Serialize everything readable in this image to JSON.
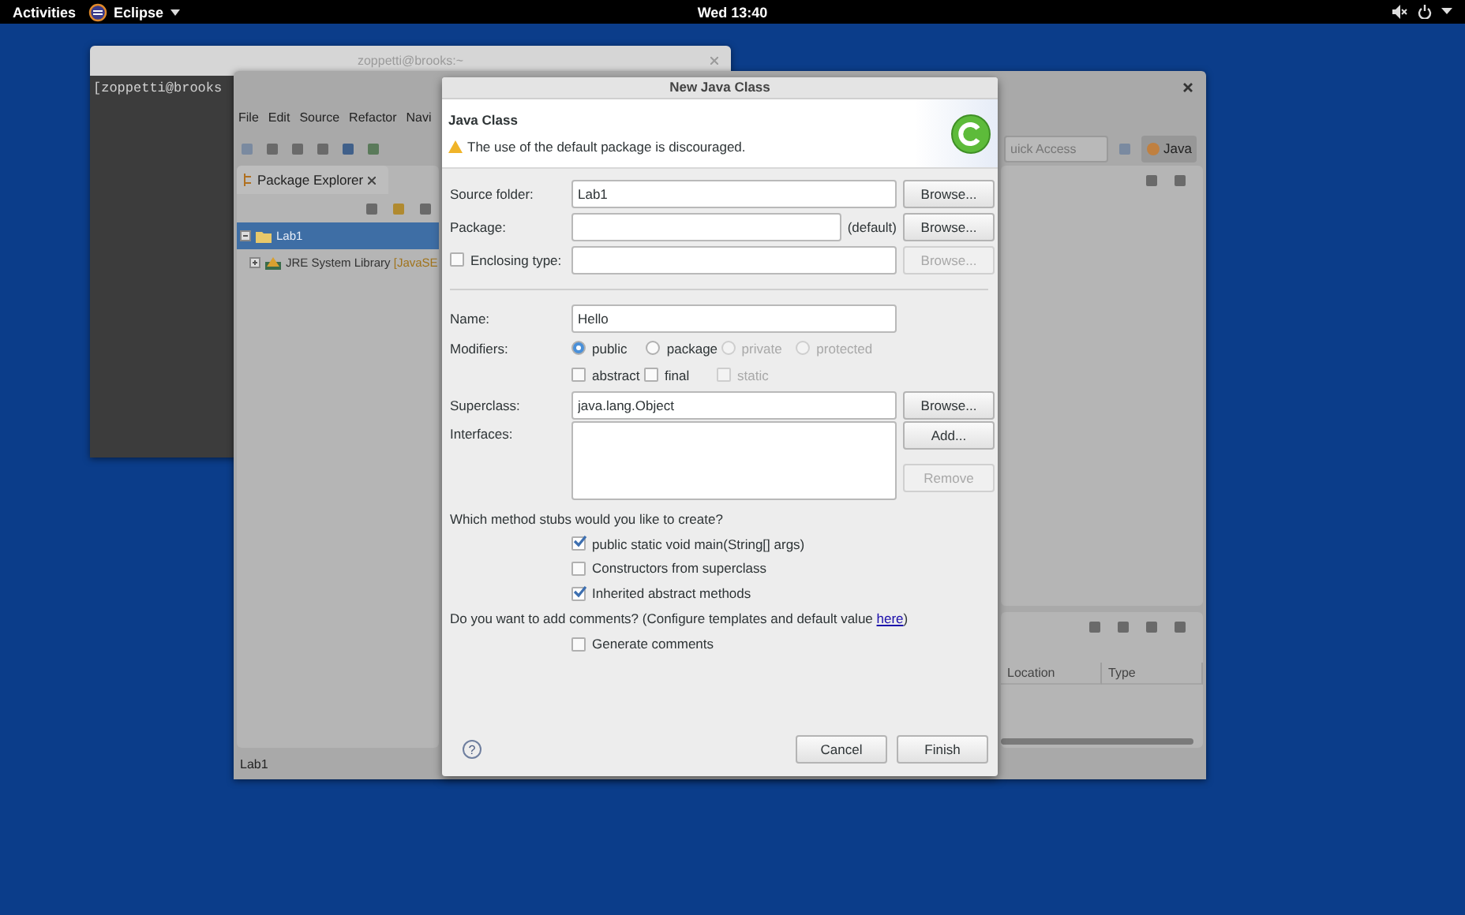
{
  "top_bar": {
    "activities": "Activities",
    "app_menu": "Eclipse",
    "clock": "Wed 13:40"
  },
  "terminal": {
    "title": "zoppetti@brooks:~",
    "prompt": "[zoppetti@brooks"
  },
  "eclipse": {
    "menus": [
      "File",
      "Edit",
      "Source",
      "Refactor",
      "Navi"
    ],
    "quick_access": {
      "placeholder": "uick Access"
    },
    "perspective": "Java",
    "package_explorer": {
      "tab": "Package Explorer",
      "tree": [
        {
          "label": "Lab1",
          "selected": true,
          "expanded": true,
          "children": [
            {
              "label": "JRE System Library",
              "suffix": "[JavaSE",
              "selected": false,
              "expanded": false
            }
          ]
        }
      ]
    },
    "bottom_panel": {
      "columns": [
        "Location",
        "Type"
      ]
    },
    "status": "Lab1"
  },
  "dialog": {
    "title": "New Java Class",
    "heading": "Java Class",
    "message": "The use of the default package is discouraged.",
    "source_folder": {
      "label": "Source folder:",
      "value": "Lab1",
      "button": {
        "label": "Browse...",
        "disabled": false
      }
    },
    "package": {
      "label": "Package:",
      "suffix": "(default)",
      "button": {
        "label": "Browse...",
        "disabled": false
      }
    },
    "enclosing_type": {
      "label": "Enclosing type:",
      "checked": false,
      "button": {
        "label": "Browse...",
        "disabled": true
      }
    },
    "name": {
      "label": "Name:",
      "value": "Hello"
    },
    "modifiers": {
      "label": "Modifiers:",
      "access": [
        {
          "label": "public",
          "selected": true,
          "disabled": false
        },
        {
          "label": "package",
          "selected": false,
          "disabled": false
        },
        {
          "label": "private",
          "selected": false,
          "disabled": true
        },
        {
          "label": "protected",
          "selected": false,
          "disabled": true
        }
      ],
      "flags": [
        {
          "label": "abstract",
          "checked": false,
          "disabled": false
        },
        {
          "label": "final",
          "checked": false,
          "disabled": false
        },
        {
          "label": "static",
          "checked": false,
          "disabled": true
        }
      ]
    },
    "superclass": {
      "label": "Superclass:",
      "value": "java.lang.Object",
      "button": {
        "label": "Browse...",
        "disabled": false
      }
    },
    "interfaces": {
      "label": "Interfaces:",
      "buttons": [
        {
          "label": "Add...",
          "disabled": false
        },
        {
          "label": "Remove",
          "disabled": true
        }
      ]
    },
    "stubs": {
      "question": "Which method stubs would you like to create?",
      "options": [
        {
          "label": "public static void main(String[] args)",
          "checked": true
        },
        {
          "label": "Constructors from superclass",
          "checked": false
        },
        {
          "label": "Inherited abstract methods",
          "checked": true
        }
      ]
    },
    "comments": {
      "question": "Do you want to add comments? (Configure templates and default value ",
      "link": "here",
      "question_end": ")",
      "options": [
        {
          "label": "Generate comments",
          "checked": false
        }
      ]
    },
    "help": "?",
    "buttons": [
      {
        "label": "Cancel"
      },
      {
        "label": "Finish"
      }
    ]
  }
}
